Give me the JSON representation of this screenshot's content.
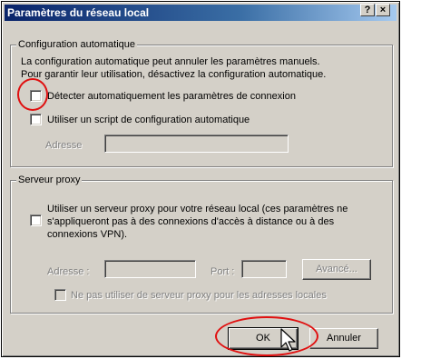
{
  "window": {
    "title": "Paramètres du réseau local",
    "help_label": "?",
    "close_label": "×"
  },
  "auto_config": {
    "legend": "Configuration automatique",
    "description_line1": "La configuration automatique peut annuler les paramètres manuels.",
    "description_line2": "Pour garantir leur utilisation, désactivez la configuration automatique.",
    "detect_label": "Détecter automatiquement les paramètres de connexion",
    "detect_checked": false,
    "script_label": "Utiliser un script de configuration automatique",
    "script_checked": false,
    "address_label": "Adresse",
    "address_value": ""
  },
  "proxy": {
    "legend": "Serveur proxy",
    "use_proxy_line1": "Utiliser un serveur proxy pour votre réseau local (ces paramètres ne",
    "use_proxy_line2": "s'appliqueront pas à des connexions d'accès à distance ou à des",
    "use_proxy_line3": "connexions VPN).",
    "use_proxy_checked": false,
    "address_label": "Adresse :",
    "address_value": "",
    "port_label": "Port :",
    "port_value": "",
    "advanced_label": "Avancé...",
    "bypass_label": "Ne pas utiliser de serveur proxy pour les adresses locales",
    "bypass_checked": false
  },
  "buttons": {
    "ok_label": "OK",
    "cancel_label": "Annuler"
  },
  "annotations": {
    "highlight_color": "#e01010"
  }
}
